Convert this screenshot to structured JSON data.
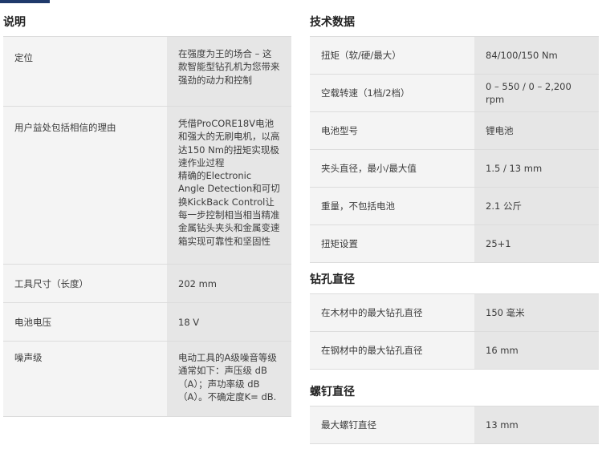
{
  "description": {
    "heading": "说明",
    "rows": [
      {
        "label": "定位",
        "value": "在强度为王的场合 – 这款智能型钻孔机为您带来强劲的动力和控制"
      },
      {
        "label": "用户益处包括相信的理由",
        "value": "凭借ProCORE18V电池和强大的无刷电机，以高达150 Nm的扭矩实现极速作业过程\n精确的Electronic Angle Detection和可切换KickBack Control让每一步控制相当相当精准\n金属钻头夹头和金属变速箱实现可靠性和坚固性"
      },
      {
        "label": "工具尺寸（长度）",
        "value": "202 mm"
      },
      {
        "label": "电池电压",
        "value": "18 V"
      },
      {
        "label": "噪声级",
        "value": "电动工具的A级噪音等级通常如下：声压级 dB（A）；声功率级 dB（A）。不确定度K= dB."
      }
    ]
  },
  "tech": {
    "heading": "技术数据",
    "rows": [
      {
        "label": "扭矩（软/硬/最大）",
        "value": "84/100/150 Nm"
      },
      {
        "label": "空载转速（1档/2档）",
        "value": "0 – 550 / 0 – 2,200 rpm"
      },
      {
        "label": "电池型号",
        "value": "锂电池"
      },
      {
        "label": "夹头直径，最小/最大值",
        "value": "1.5 / 13 mm"
      },
      {
        "label": "重量，不包括电池",
        "value": "2.1 公斤"
      },
      {
        "label": "扭矩设置",
        "value": "25+1"
      }
    ]
  },
  "drill": {
    "heading": "钻孔直径",
    "rows": [
      {
        "label": "在木材中的最大钻孔直径",
        "value": "150 毫米"
      },
      {
        "label": "在钢材中的最大钻孔直径",
        "value": "16 mm"
      }
    ]
  },
  "screw": {
    "heading": "螺钉直径",
    "rows": [
      {
        "label": "最大螺钉直径",
        "value": "13 mm"
      }
    ]
  }
}
